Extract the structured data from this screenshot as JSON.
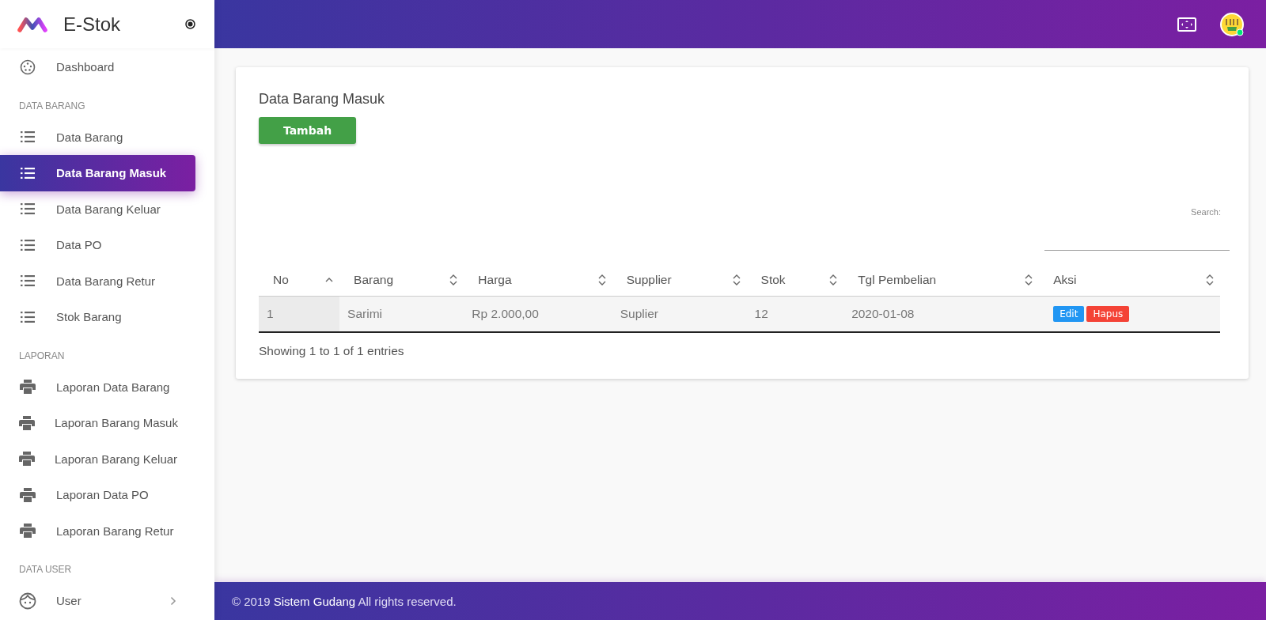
{
  "sidebar": {
    "brand": "E-Stok",
    "items": [
      {
        "kind": "dashboard",
        "label": "Dashboard",
        "selected": false
      },
      {
        "kind": "header",
        "label": "DATA BARANG"
      },
      {
        "kind": "list",
        "label": "Data Barang",
        "selected": false
      },
      {
        "kind": "list",
        "label": "Data Barang Masuk",
        "selected": true
      },
      {
        "kind": "list",
        "label": "Data Barang Keluar",
        "selected": false
      },
      {
        "kind": "list",
        "label": "Data PO",
        "selected": false
      },
      {
        "kind": "list",
        "label": "Data Barang Retur",
        "selected": false
      },
      {
        "kind": "list",
        "label": "Stok Barang",
        "selected": false
      },
      {
        "kind": "header",
        "label": "LAPORAN"
      },
      {
        "kind": "print",
        "label": "Laporan Data Barang",
        "selected": false
      },
      {
        "kind": "print",
        "label": "Laporan Barang Masuk",
        "selected": false
      },
      {
        "kind": "print",
        "label": "Laporan Barang Keluar",
        "selected": false
      },
      {
        "kind": "print",
        "label": "Laporan Data PO",
        "selected": false
      },
      {
        "kind": "print",
        "label": "Laporan Barang Retur",
        "selected": false
      },
      {
        "kind": "header",
        "label": "DATA USER"
      },
      {
        "kind": "user",
        "label": "User",
        "selected": false,
        "expanded": false
      }
    ]
  },
  "card": {
    "title": "Data Barang Masuk",
    "add_button": "Tambah",
    "search": {
      "label": "Search:"
    },
    "table": {
      "columns": [
        {
          "label": "No",
          "sorted": true
        },
        {
          "label": "Barang",
          "sorted": false
        },
        {
          "label": "Harga",
          "sorted": false
        },
        {
          "label": "Supplier",
          "sorted": false
        },
        {
          "label": "Stok",
          "sorted": false
        },
        {
          "label": "Tgl Pembelian",
          "sorted": false
        },
        {
          "label": "Aksi",
          "sorted": false
        }
      ],
      "rows": [
        {
          "cells": [
            "1",
            "Sarimi",
            "Rp 2.000,00",
            "Suplier",
            "12",
            "2020-01-08"
          ],
          "actions": [
            "Edit",
            "Hapus"
          ]
        }
      ]
    },
    "info": "Showing 1 to 1 of 1 entries"
  },
  "footer": {
    "text": "© 2019 **Sistem Gudang** All rights reserved."
  }
}
